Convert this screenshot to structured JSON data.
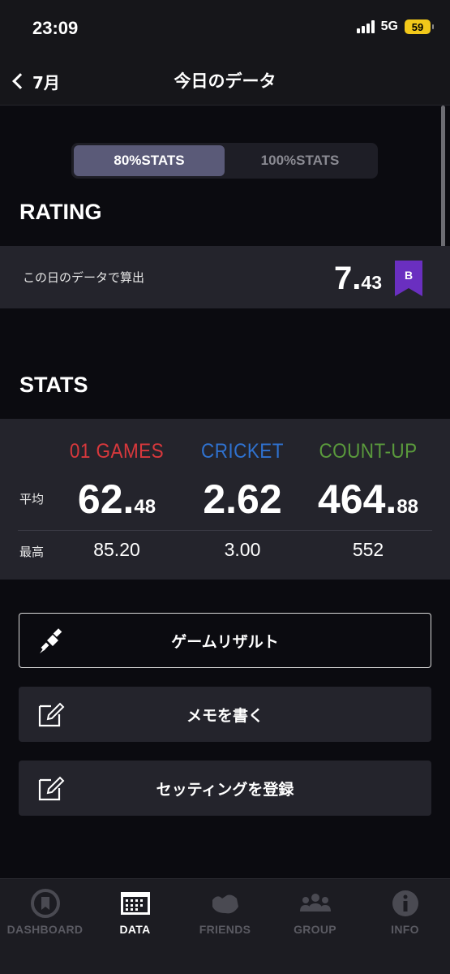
{
  "status_bar": {
    "time": "23:09",
    "network": "5G",
    "battery": "59"
  },
  "nav": {
    "back_label": "7月",
    "title": "今日のデータ"
  },
  "segmented": {
    "options": [
      "80%STATS",
      "100%STATS"
    ],
    "selected": "80%STATS"
  },
  "rating": {
    "heading": "RATING",
    "description": "この日のデータで算出",
    "value_int": "7.",
    "value_dec": "43",
    "rank": "B",
    "rank_color": "#6a2fc0"
  },
  "stats": {
    "heading": "STATS",
    "avg_label": "平均",
    "max_label": "最高",
    "games": [
      {
        "name": "01 GAMES",
        "color": "#d8383c",
        "avg_int": "62.",
        "avg_dec": "48",
        "max": "85.20"
      },
      {
        "name": "CRICKET",
        "color": "#2f72d0",
        "avg_int": "2.62",
        "avg_dec": "",
        "max": "3.00"
      },
      {
        "name": "COUNT-UP",
        "color": "#5a9a3c",
        "avg_int": "464.",
        "avg_dec": "88",
        "max": "552"
      }
    ]
  },
  "actions": [
    {
      "label": "ゲームリザルト",
      "icon": "dart-icon"
    },
    {
      "label": "メモを書く",
      "icon": "edit-icon"
    },
    {
      "label": "セッティングを登録",
      "icon": "edit-icon"
    }
  ],
  "tabs": [
    {
      "label": "DASHBOARD",
      "icon": "dashboard-icon"
    },
    {
      "label": "DATA",
      "icon": "calendar-icon",
      "active": true
    },
    {
      "label": "FRIENDS",
      "icon": "friends-icon"
    },
    {
      "label": "GROUP",
      "icon": "group-icon"
    },
    {
      "label": "INFO",
      "icon": "info-icon"
    }
  ]
}
